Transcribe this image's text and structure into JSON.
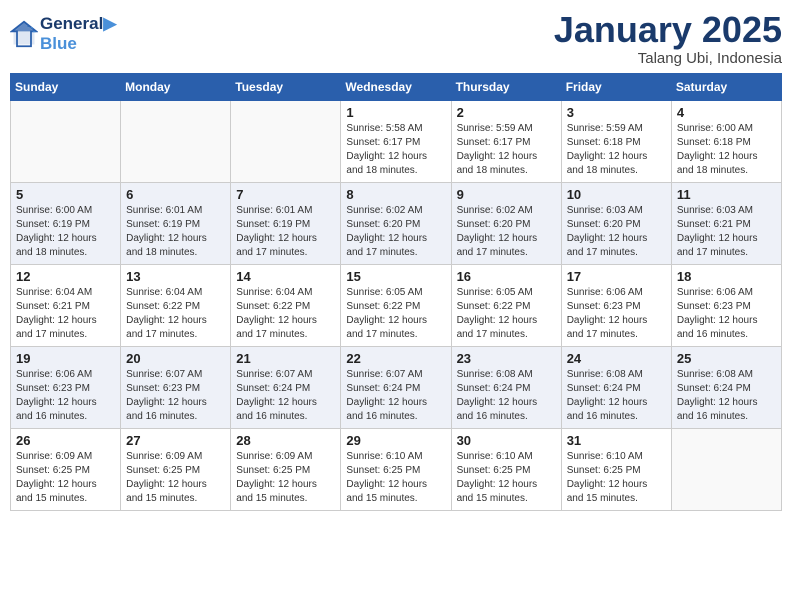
{
  "header": {
    "logo_line1": "General",
    "logo_line2": "Blue",
    "month": "January 2025",
    "location": "Talang Ubi, Indonesia"
  },
  "days_of_week": [
    "Sunday",
    "Monday",
    "Tuesday",
    "Wednesday",
    "Thursday",
    "Friday",
    "Saturday"
  ],
  "weeks": [
    [
      {
        "num": "",
        "info": ""
      },
      {
        "num": "",
        "info": ""
      },
      {
        "num": "",
        "info": ""
      },
      {
        "num": "1",
        "info": "Sunrise: 5:58 AM\nSunset: 6:17 PM\nDaylight: 12 hours\nand 18 minutes."
      },
      {
        "num": "2",
        "info": "Sunrise: 5:59 AM\nSunset: 6:17 PM\nDaylight: 12 hours\nand 18 minutes."
      },
      {
        "num": "3",
        "info": "Sunrise: 5:59 AM\nSunset: 6:18 PM\nDaylight: 12 hours\nand 18 minutes."
      },
      {
        "num": "4",
        "info": "Sunrise: 6:00 AM\nSunset: 6:18 PM\nDaylight: 12 hours\nand 18 minutes."
      }
    ],
    [
      {
        "num": "5",
        "info": "Sunrise: 6:00 AM\nSunset: 6:19 PM\nDaylight: 12 hours\nand 18 minutes."
      },
      {
        "num": "6",
        "info": "Sunrise: 6:01 AM\nSunset: 6:19 PM\nDaylight: 12 hours\nand 18 minutes."
      },
      {
        "num": "7",
        "info": "Sunrise: 6:01 AM\nSunset: 6:19 PM\nDaylight: 12 hours\nand 17 minutes."
      },
      {
        "num": "8",
        "info": "Sunrise: 6:02 AM\nSunset: 6:20 PM\nDaylight: 12 hours\nand 17 minutes."
      },
      {
        "num": "9",
        "info": "Sunrise: 6:02 AM\nSunset: 6:20 PM\nDaylight: 12 hours\nand 17 minutes."
      },
      {
        "num": "10",
        "info": "Sunrise: 6:03 AM\nSunset: 6:20 PM\nDaylight: 12 hours\nand 17 minutes."
      },
      {
        "num": "11",
        "info": "Sunrise: 6:03 AM\nSunset: 6:21 PM\nDaylight: 12 hours\nand 17 minutes."
      }
    ],
    [
      {
        "num": "12",
        "info": "Sunrise: 6:04 AM\nSunset: 6:21 PM\nDaylight: 12 hours\nand 17 minutes."
      },
      {
        "num": "13",
        "info": "Sunrise: 6:04 AM\nSunset: 6:22 PM\nDaylight: 12 hours\nand 17 minutes."
      },
      {
        "num": "14",
        "info": "Sunrise: 6:04 AM\nSunset: 6:22 PM\nDaylight: 12 hours\nand 17 minutes."
      },
      {
        "num": "15",
        "info": "Sunrise: 6:05 AM\nSunset: 6:22 PM\nDaylight: 12 hours\nand 17 minutes."
      },
      {
        "num": "16",
        "info": "Sunrise: 6:05 AM\nSunset: 6:22 PM\nDaylight: 12 hours\nand 17 minutes."
      },
      {
        "num": "17",
        "info": "Sunrise: 6:06 AM\nSunset: 6:23 PM\nDaylight: 12 hours\nand 17 minutes."
      },
      {
        "num": "18",
        "info": "Sunrise: 6:06 AM\nSunset: 6:23 PM\nDaylight: 12 hours\nand 16 minutes."
      }
    ],
    [
      {
        "num": "19",
        "info": "Sunrise: 6:06 AM\nSunset: 6:23 PM\nDaylight: 12 hours\nand 16 minutes."
      },
      {
        "num": "20",
        "info": "Sunrise: 6:07 AM\nSunset: 6:23 PM\nDaylight: 12 hours\nand 16 minutes."
      },
      {
        "num": "21",
        "info": "Sunrise: 6:07 AM\nSunset: 6:24 PM\nDaylight: 12 hours\nand 16 minutes."
      },
      {
        "num": "22",
        "info": "Sunrise: 6:07 AM\nSunset: 6:24 PM\nDaylight: 12 hours\nand 16 minutes."
      },
      {
        "num": "23",
        "info": "Sunrise: 6:08 AM\nSunset: 6:24 PM\nDaylight: 12 hours\nand 16 minutes."
      },
      {
        "num": "24",
        "info": "Sunrise: 6:08 AM\nSunset: 6:24 PM\nDaylight: 12 hours\nand 16 minutes."
      },
      {
        "num": "25",
        "info": "Sunrise: 6:08 AM\nSunset: 6:24 PM\nDaylight: 12 hours\nand 16 minutes."
      }
    ],
    [
      {
        "num": "26",
        "info": "Sunrise: 6:09 AM\nSunset: 6:25 PM\nDaylight: 12 hours\nand 15 minutes."
      },
      {
        "num": "27",
        "info": "Sunrise: 6:09 AM\nSunset: 6:25 PM\nDaylight: 12 hours\nand 15 minutes."
      },
      {
        "num": "28",
        "info": "Sunrise: 6:09 AM\nSunset: 6:25 PM\nDaylight: 12 hours\nand 15 minutes."
      },
      {
        "num": "29",
        "info": "Sunrise: 6:10 AM\nSunset: 6:25 PM\nDaylight: 12 hours\nand 15 minutes."
      },
      {
        "num": "30",
        "info": "Sunrise: 6:10 AM\nSunset: 6:25 PM\nDaylight: 12 hours\nand 15 minutes."
      },
      {
        "num": "31",
        "info": "Sunrise: 6:10 AM\nSunset: 6:25 PM\nDaylight: 12 hours\nand 15 minutes."
      },
      {
        "num": "",
        "info": ""
      }
    ]
  ]
}
